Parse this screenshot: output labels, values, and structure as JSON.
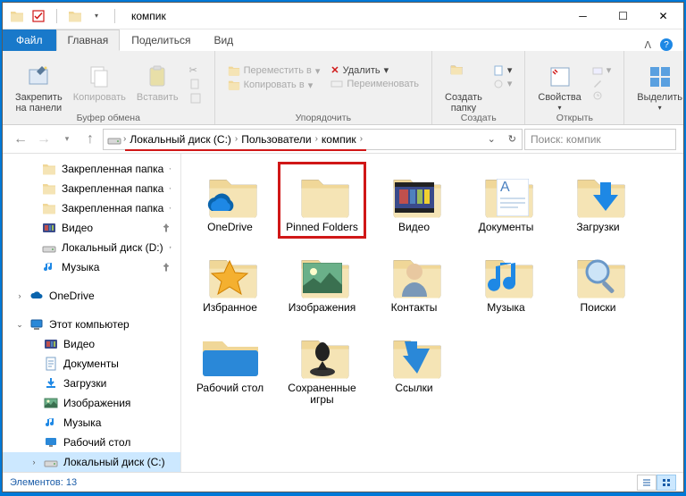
{
  "title": "компик",
  "tabs": {
    "file": "Файл",
    "home": "Главная",
    "share": "Поделиться",
    "view": "Вид"
  },
  "ribbon": {
    "pin": "Закрепить на панели\nбыстрого доступа",
    "copy": "Копировать",
    "paste": "Вставить",
    "clipboard_group": "Буфер обмена",
    "move_to": "Переместить в",
    "copy_to": "Копировать в",
    "delete": "Удалить",
    "rename": "Переименовать",
    "organize_group": "Упорядочить",
    "new_folder": "Создать\nпапку",
    "new_group": "Создать",
    "properties": "Свойства",
    "open_group": "Открыть",
    "select": "Выделить"
  },
  "breadcrumb": {
    "segs": [
      "Локальный диск (C:)",
      "Пользователи",
      "компик"
    ]
  },
  "search_placeholder": "Поиск: компик",
  "sidebar": {
    "pinned": [
      {
        "label": "Закрепленная папка",
        "type": "folder",
        "pin": true
      },
      {
        "label": "Закрепленная папка",
        "type": "folder",
        "pin": true
      },
      {
        "label": "Закрепленная папка",
        "type": "folder",
        "pin": true
      },
      {
        "label": "Видео",
        "type": "video",
        "pin": true
      },
      {
        "label": "Локальный диск (D:)",
        "type": "drive",
        "pin": true
      },
      {
        "label": "Музыка",
        "type": "music",
        "pin": true
      }
    ],
    "onedrive": "OneDrive",
    "thispc": "Этот компьютер",
    "pc_items": [
      {
        "label": "Видео",
        "type": "video"
      },
      {
        "label": "Документы",
        "type": "docs"
      },
      {
        "label": "Загрузки",
        "type": "downloads"
      },
      {
        "label": "Изображения",
        "type": "images"
      },
      {
        "label": "Музыка",
        "type": "music"
      },
      {
        "label": "Рабочий стол",
        "type": "desktop"
      },
      {
        "label": "Локальный диск (C:)",
        "type": "drive",
        "selected": true
      }
    ]
  },
  "items": [
    {
      "label": "OneDrive",
      "icon": "onedrive"
    },
    {
      "label": "Pinned Folders",
      "icon": "folder",
      "highlighted": true
    },
    {
      "label": "Видео",
      "icon": "video"
    },
    {
      "label": "Документы",
      "icon": "docs"
    },
    {
      "label": "Загрузки",
      "icon": "downloads"
    },
    {
      "label": "Избранное",
      "icon": "favorites"
    },
    {
      "label": "Изображения",
      "icon": "images"
    },
    {
      "label": "Контакты",
      "icon": "contacts"
    },
    {
      "label": "Музыка",
      "icon": "music"
    },
    {
      "label": "Поиски",
      "icon": "search"
    },
    {
      "label": "Рабочий стол",
      "icon": "desktop"
    },
    {
      "label": "Сохраненные игры",
      "icon": "games"
    },
    {
      "label": "Ссылки",
      "icon": "links"
    }
  ],
  "status": "Элементов: 13"
}
